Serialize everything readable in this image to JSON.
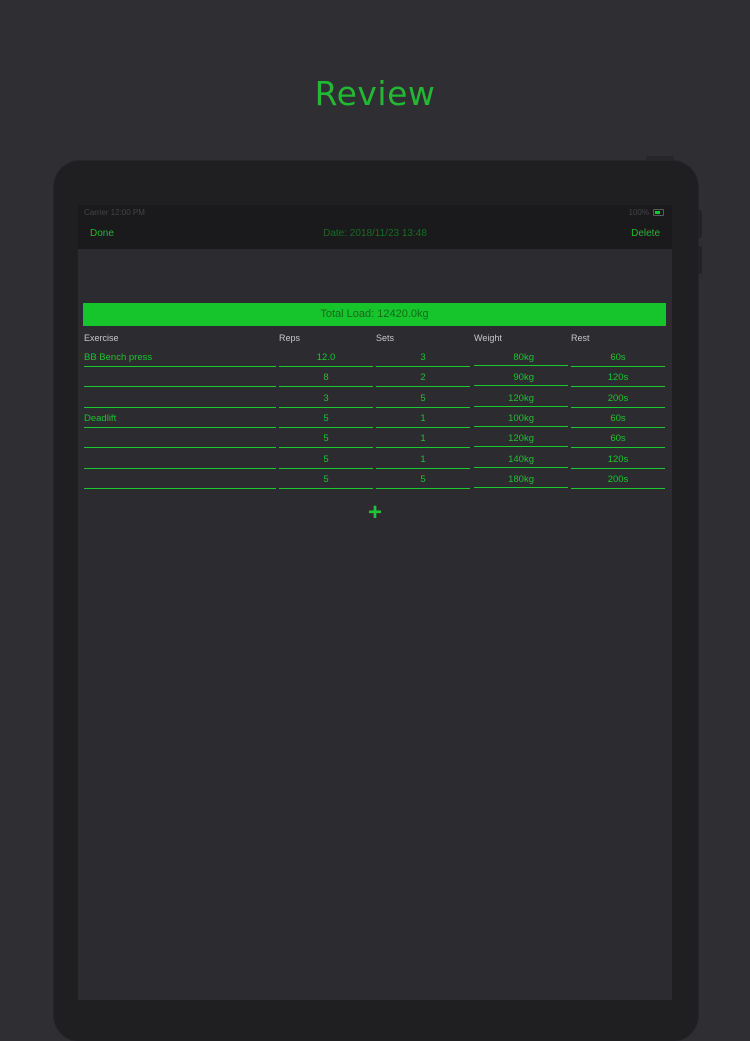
{
  "headline": "Review",
  "status": {
    "left": "Carrier  12:00 PM",
    "right": "100%"
  },
  "nav": {
    "done_label": "Done",
    "title": "Date: 2018/11/23 13:48",
    "delete_label": "Delete"
  },
  "total_load": "Total Load: 12420.0kg",
  "columns": {
    "exercise": "Exercise",
    "reps": "Reps",
    "sets": "Sets",
    "weight": "Weight",
    "rest": "Rest"
  },
  "rows": [
    {
      "exercise": "BB Bench press",
      "reps": "12.0",
      "sets": "3",
      "weight": "80kg",
      "rest": "60s"
    },
    {
      "exercise": "",
      "reps": "8",
      "sets": "2",
      "weight": "90kg",
      "rest": "120s"
    },
    {
      "exercise": "",
      "reps": "3",
      "sets": "5",
      "weight": "120kg",
      "rest": "200s"
    },
    {
      "exercise": "Deadlift",
      "reps": "5",
      "sets": "1",
      "weight": "100kg",
      "rest": "60s"
    },
    {
      "exercise": "",
      "reps": "5",
      "sets": "1",
      "weight": "120kg",
      "rest": "60s"
    },
    {
      "exercise": "",
      "reps": "5",
      "sets": "1",
      "weight": "140kg",
      "rest": "120s"
    },
    {
      "exercise": "",
      "reps": "5",
      "sets": "5",
      "weight": "180kg",
      "rest": "200s"
    }
  ],
  "add_icon": "+",
  "colors": {
    "accent": "#1dc331",
    "total_bar": "#16c42b",
    "background": "#2f2e32"
  }
}
